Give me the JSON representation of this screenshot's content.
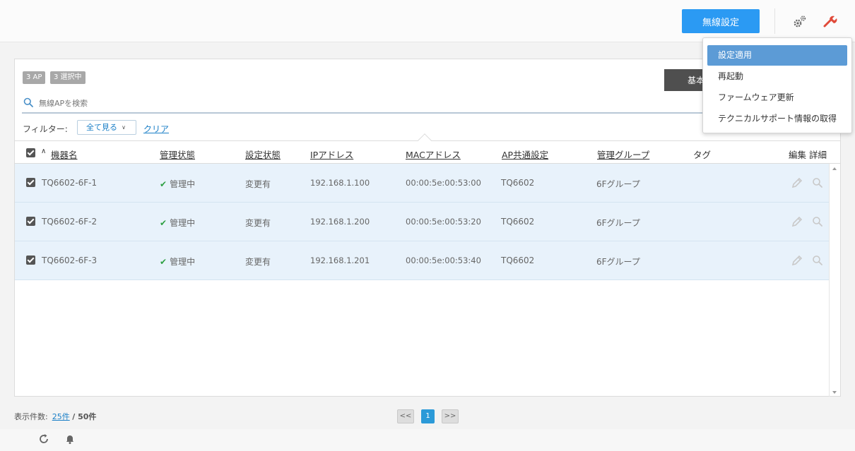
{
  "topbar": {
    "wireless_button": "無線設定",
    "gear_icon": "gears-icon",
    "wrench_icon": "wrench-icon"
  },
  "dropdown": {
    "items": [
      {
        "label": "設定適用",
        "active": true
      },
      {
        "label": "再起動"
      },
      {
        "label": "ファームウェア更新"
      },
      {
        "label": "テクニカルサポート情報の取得"
      }
    ]
  },
  "panel": {
    "badge_ap": "3 AP",
    "badge_selected": "3 選択中",
    "basic_button": "基本",
    "search": {
      "placeholder": "無線APを検索",
      "value": ""
    },
    "filter": {
      "label": "フィルター:",
      "select_value": "全て見る",
      "clear": "クリア"
    }
  },
  "table": {
    "columns": {
      "name": "機器名",
      "mgmt_status": "管理状態",
      "config_status": "設定状態",
      "ip": "IPアドレス",
      "mac": "MACアドレス",
      "ap_common": "AP共通設定",
      "group": "管理グループ",
      "tag": "タグ",
      "edit": "編集",
      "detail": "詳細"
    },
    "rows": [
      {
        "name": "TQ6602-6F-1",
        "mgmt_status": "管理中",
        "config_status": "変更有",
        "ip": "192.168.1.100",
        "mac": "00:00:5e:00:53:00",
        "ap_common": "TQ6602",
        "group": "6Fグループ",
        "tag": ""
      },
      {
        "name": "TQ6602-6F-2",
        "mgmt_status": "管理中",
        "config_status": "変更有",
        "ip": "192.168.1.200",
        "mac": "00:00:5e:00:53:20",
        "ap_common": "TQ6602",
        "group": "6Fグループ",
        "tag": ""
      },
      {
        "name": "TQ6602-6F-3",
        "mgmt_status": "管理中",
        "config_status": "変更有",
        "ip": "192.168.1.201",
        "mac": "00:00:5e:00:53:40",
        "ap_common": "TQ6602",
        "group": "6Fグループ",
        "tag": ""
      }
    ]
  },
  "footer": {
    "count_label": "表示件数:",
    "per_page": "25件",
    "total": "/ 50件",
    "prev": "<<",
    "current_page": "1",
    "next": ">>"
  },
  "colors": {
    "accent": "#2b9af3",
    "row_selected": "#e8f2fb",
    "menu_active": "#5c9bd6",
    "status_ok": "#2ea043",
    "wrench": "#e04a3a"
  }
}
